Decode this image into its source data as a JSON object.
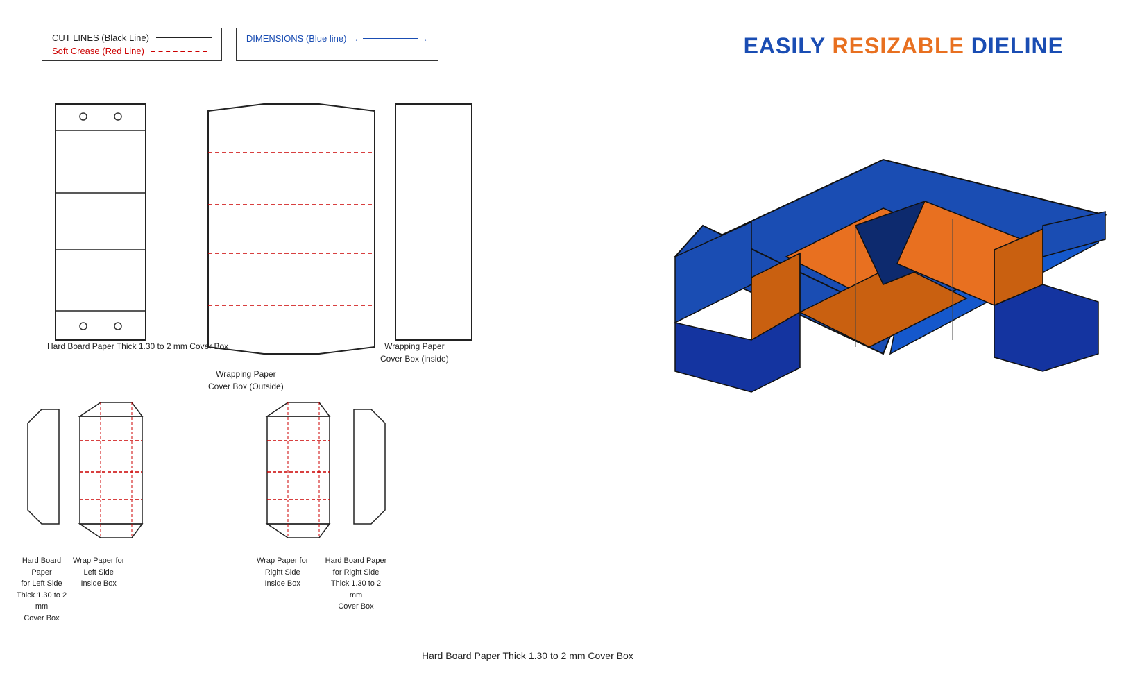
{
  "title": {
    "easily": "EASILY",
    "resizable": "RESIZABLE",
    "dieline": "DIELINE"
  },
  "legend": {
    "cut_lines_label": "CUT LINES (Black Line)",
    "soft_crease_label": "Soft Crease (Red Line)",
    "dimensions_label": "DIMENSIONS (Blue line)"
  },
  "captions": {
    "hardboard": "Hard Board Paper\nThick 1.30 to 2 mm\nCover Box",
    "wrap_outside": "Wrapping Paper\nCover Box (Outside)",
    "wrap_inside": "Wrapping Paper\nCover Box (inside)",
    "bottom_left_hb": "Hard Board Paper\nfor Left Side\nThick 1.30 to 2 mm\nCover Box",
    "bottom_left_wrap": "Wrap Paper for\nLeft Side\nInside Box",
    "bottom_right_wrap": "Wrap Paper for\nRight Side\nInside Box",
    "bottom_right_hb": "Hard Board Paper\nfor Right Side\nThick 1.30 to 2 mm\nCover Box"
  },
  "colors": {
    "blue": "#1a4db3",
    "orange": "#e87020",
    "black": "#222222",
    "red": "#cc0000",
    "white": "#ffffff"
  }
}
